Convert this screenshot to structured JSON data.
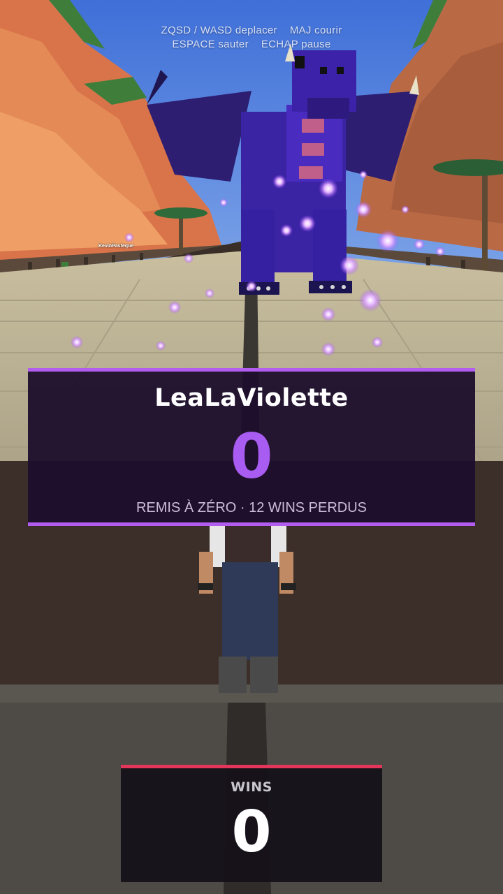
{
  "hud": {
    "controls_line1_a": "ZQSD / WASD deplacer",
    "controls_line1_b": "MAJ courir",
    "controls_line2_a": "ESPACE sauter",
    "controls_line2_b": "ECHAP pause"
  },
  "world": {
    "other_player_name": "KevinPasteque"
  },
  "reset_banner": {
    "player_name": "LeaLaViolette",
    "count": "0",
    "subtitle": "REMIS À ZÉRO · 12 WINS PERDUS",
    "accent_color": "#b25cf0"
  },
  "wins_counter": {
    "label": "WINS",
    "value": "0",
    "accent_color": "#e4365a"
  }
}
